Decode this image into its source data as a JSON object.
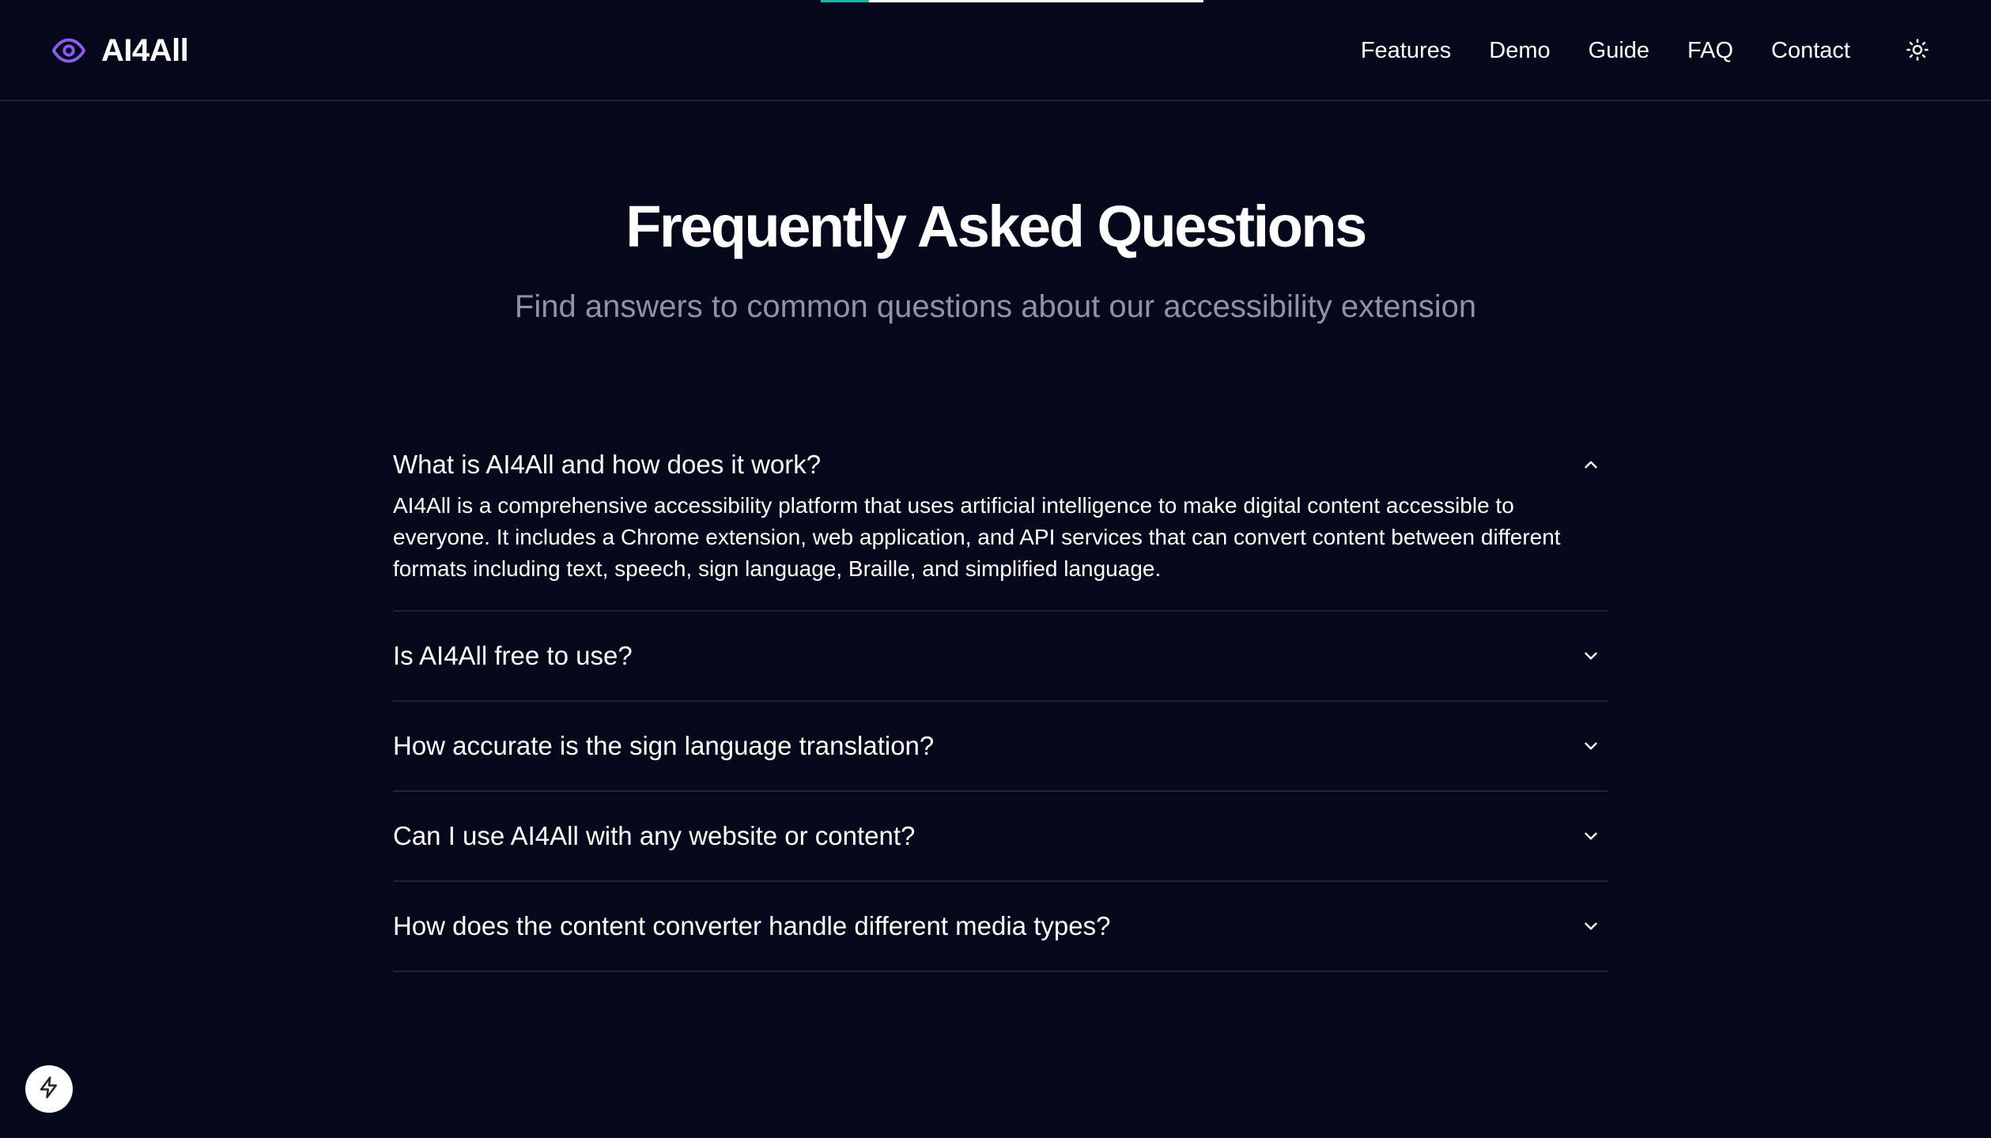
{
  "brand": {
    "name": "AI4All",
    "accent_color": "#8b5cf6",
    "icon": "eye-icon"
  },
  "scroll_progress": {
    "fraction": 0.125,
    "fill_color": "#14b8a6"
  },
  "nav": {
    "items": [
      {
        "label": "Features"
      },
      {
        "label": "Demo"
      },
      {
        "label": "Guide"
      },
      {
        "label": "FAQ"
      },
      {
        "label": "Contact"
      }
    ],
    "theme_toggle_icon": "sun-icon"
  },
  "faq": {
    "title": "Frequently Asked Questions",
    "subtitle": "Find answers to common questions about our accessibility extension",
    "items": [
      {
        "question": "What is AI4All and how does it work?",
        "answer": "AI4All is a comprehensive accessibility platform that uses artificial intelligence to make digital content accessible to everyone. It includes a Chrome extension, web application, and API services that can convert content between different formats including text, speech, sign language, Braille, and simplified language.",
        "expanded": true
      },
      {
        "question": "Is AI4All free to use?",
        "expanded": false
      },
      {
        "question": "How accurate is the sign language translation?",
        "expanded": false
      },
      {
        "question": "Can I use AI4All with any website or content?",
        "expanded": false
      },
      {
        "question": "How does the content converter handle different media types?",
        "expanded": false
      }
    ]
  },
  "dev_tools_button": {
    "icon": "lightning-bolt-icon"
  }
}
